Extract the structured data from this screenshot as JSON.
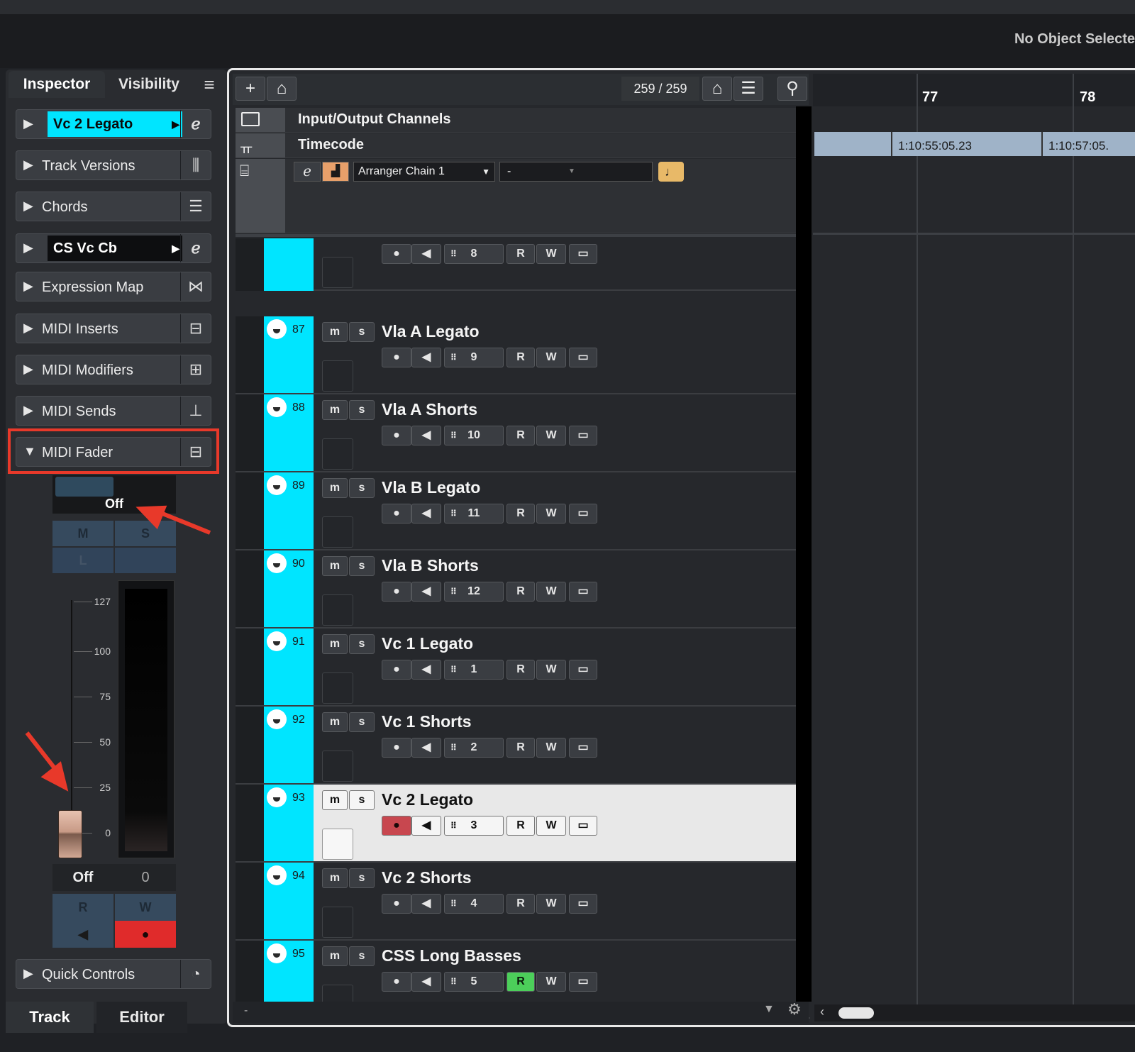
{
  "header": {
    "status_text": "No Object Selecte"
  },
  "inspector": {
    "tabs": [
      "Inspector",
      "Visibility"
    ],
    "menu_icon": "≡",
    "track_name": "Vc 2 Legato",
    "track_versions": "Track Versions",
    "chords": "Chords",
    "instrument_name": "CS Vc Cb",
    "expression_map": "Expression Map",
    "midi_inserts": "MIDI Inserts",
    "midi_modifiers": "MIDI Modifiers",
    "midi_sends": "MIDI Sends",
    "midi_fader": "MIDI Fader",
    "quick_controls": "Quick Controls",
    "fader": {
      "pan_value": "Off",
      "mute": "M",
      "solo": "S",
      "listen": "L",
      "scale": [
        "127",
        "100",
        "75",
        "50",
        "25",
        "0"
      ],
      "volume_label": "Off",
      "volume_value": "0",
      "read": "R",
      "write": "W"
    }
  },
  "bottom_tabs": [
    "Track",
    "Editor"
  ],
  "toolbar": {
    "track_count": "259 / 259"
  },
  "global_tracks": {
    "io_channels": "Input/Output Channels",
    "timecode": "Timecode",
    "arranger_chain": "Arranger Chain 1",
    "arranger_dash": "-"
  },
  "tracks": [
    {
      "num": "",
      "name": "",
      "channel": "8",
      "read_active": false,
      "selected": false
    },
    {
      "num": "87",
      "name": "Vla A Legato",
      "channel": "9",
      "read_active": false,
      "selected": false
    },
    {
      "num": "88",
      "name": "Vla A Shorts",
      "channel": "10",
      "read_active": false,
      "selected": false
    },
    {
      "num": "89",
      "name": "Vla B Legato",
      "channel": "11",
      "read_active": false,
      "selected": false
    },
    {
      "num": "90",
      "name": "Vla B Shorts",
      "channel": "12",
      "read_active": false,
      "selected": false
    },
    {
      "num": "91",
      "name": "Vc 1 Legato",
      "channel": "1",
      "read_active": false,
      "selected": false
    },
    {
      "num": "92",
      "name": "Vc 1 Shorts",
      "channel": "2",
      "read_active": false,
      "selected": false
    },
    {
      "num": "93",
      "name": "Vc 2 Legato",
      "channel": "3",
      "read_active": false,
      "selected": true
    },
    {
      "num": "94",
      "name": "Vc 2 Shorts",
      "channel": "4",
      "read_active": false,
      "selected": false
    },
    {
      "num": "95",
      "name": "CSS Long Basses",
      "channel": "5",
      "read_active": true,
      "selected": false
    }
  ],
  "track_buttons": {
    "mute": "m",
    "solo": "s",
    "read": "R",
    "write": "W"
  },
  "timeline": {
    "bars": [
      "77",
      "78"
    ],
    "timecodes": [
      "1:10:55:05.23",
      "1:10:57:05."
    ]
  },
  "colors": {
    "track_color": "#00e5ff",
    "highlight": "#e8392a",
    "record": "#e02b2b",
    "read_active": "#4ccf5a"
  }
}
